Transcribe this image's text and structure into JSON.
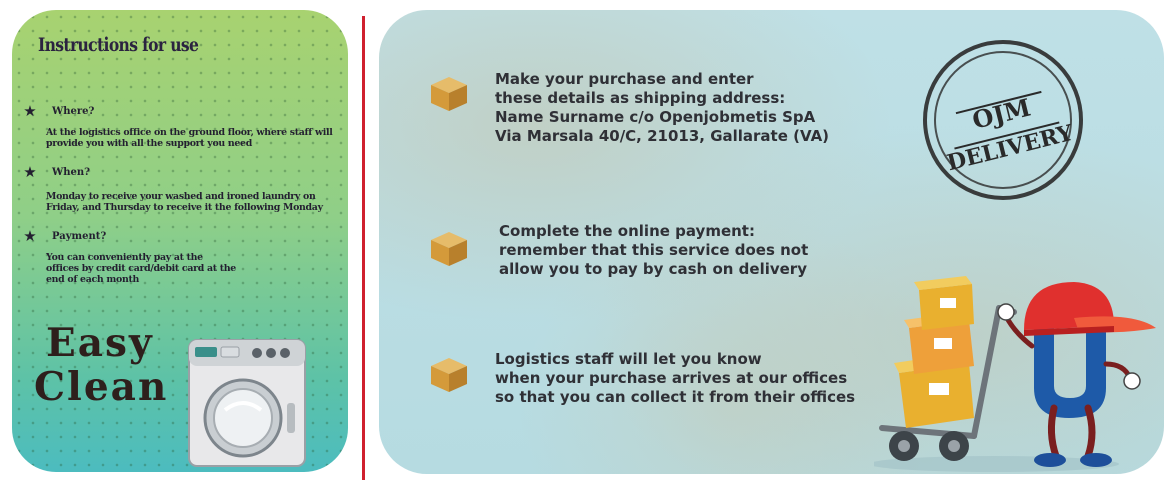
{
  "instructions": {
    "title": "Instructions for use",
    "items": [
      {
        "question": "Where?",
        "answer": "At the logistics office on the ground floor, where staff will provide you with all the support you need"
      },
      {
        "question": "When?",
        "answer": "Monday to receive your washed and ironed laundry on Friday, and Thursday to receive it the following Monday"
      },
      {
        "question": "Payment?",
        "answer": "You can conveniently pay at the offices by credit card/debit card at the end of each month"
      }
    ],
    "brand_line1": "Easy",
    "brand_line2": "Clean"
  },
  "delivery": {
    "steps": [
      {
        "lines": [
          "Make your purchase and enter",
          "these details as shipping address:",
          "Name Surname c/o Openjobmetis SpA",
          "Via Marsala 40/C, 21013, Gallarate (VA)"
        ]
      },
      {
        "lines": [
          "Complete the online payment:",
          "remember that this service does not",
          "allow you to pay by cash on delivery"
        ]
      },
      {
        "lines": [
          "Logistics staff will let you know",
          "when your purchase arrives at our offices",
          "so that you can collect it from their offices"
        ]
      }
    ],
    "stamp_line1": "OJM",
    "stamp_line2": "DELIVERY"
  },
  "colors": {
    "divider": "#d0202f",
    "accent_red": "#e0302e",
    "accent_blue": "#1e5aa8",
    "box_orange": "#e8a83a"
  },
  "icons": [
    "star-icon",
    "washing-machine-icon",
    "box-icon",
    "stamp-icon",
    "courier-mascot-illustration"
  ]
}
